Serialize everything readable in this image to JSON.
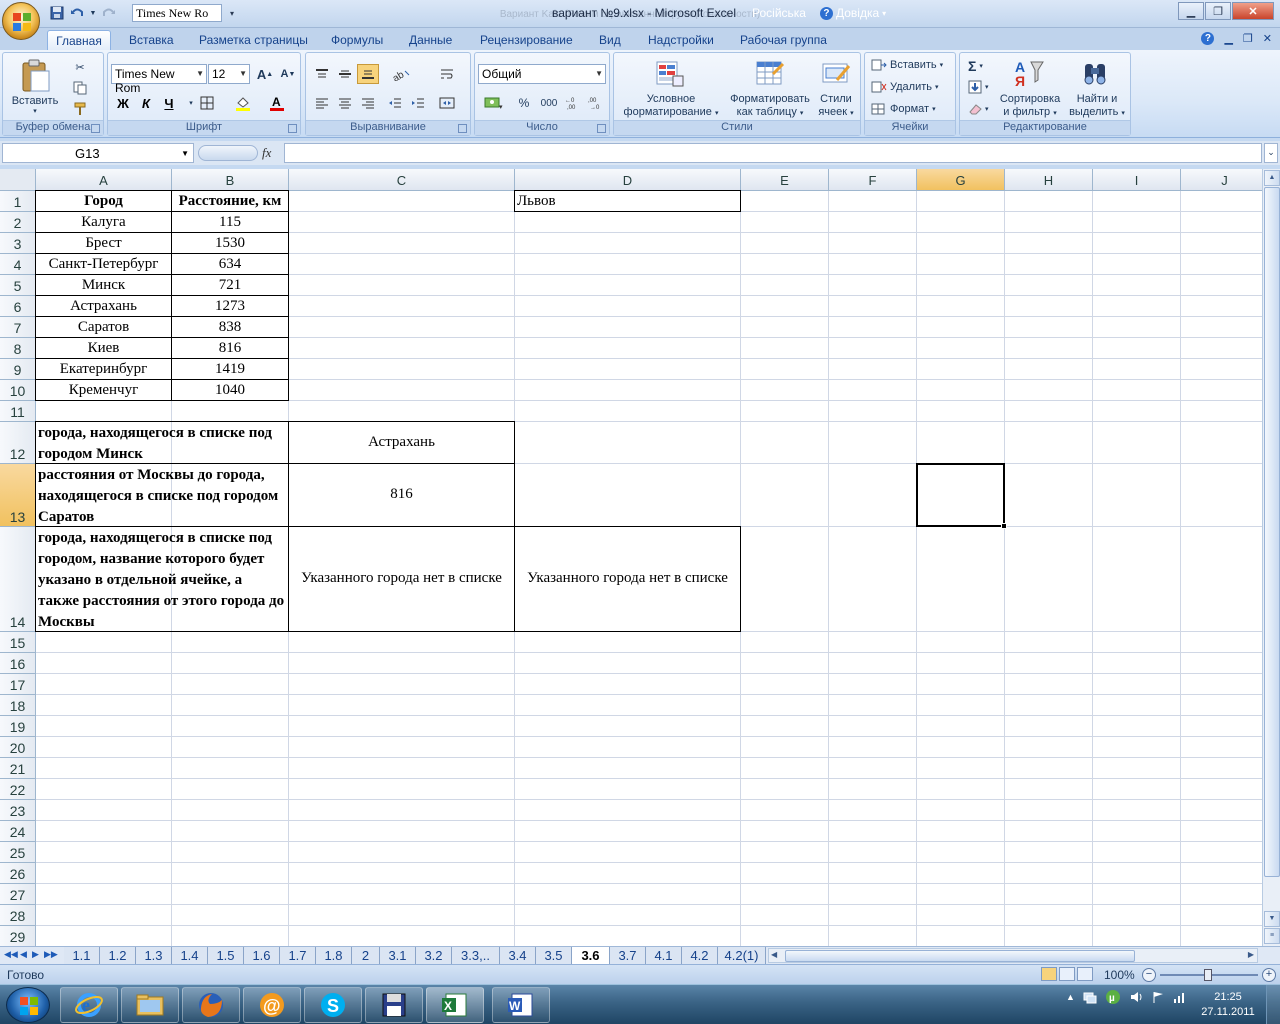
{
  "window": {
    "title": "вариант №9.xlsx - Microsoft Excel",
    "title_faded": "Вариант Kalo (Режим ограниченной функциональности)",
    "language": "Російська",
    "help_label": "Довідка",
    "qat_font": "Times New Ro"
  },
  "tabs": [
    "Главная",
    "Вставка",
    "Разметка страницы",
    "Формулы",
    "Данные",
    "Рецензирование",
    "Вид",
    "Надстройки",
    "Рабочая группа"
  ],
  "ribbon": {
    "clipboard": {
      "paste": "Вставить",
      "label": "Буфер обмена"
    },
    "font": {
      "name": "Times New Rom",
      "size": "12",
      "bold": "Ж",
      "italic": "К",
      "underline": "Ч",
      "label": "Шрифт"
    },
    "alignment": {
      "label": "Выравнивание"
    },
    "number": {
      "format": "Общий",
      "percent": "%",
      "thousands": "000",
      "label": "Число"
    },
    "styles": {
      "conditional": "Условное\nформатирование",
      "conditional_l1": "Условное",
      "conditional_l2": "форматирование",
      "table_l1": "Форматировать",
      "table_l2": "как таблицу",
      "cell_l1": "Стили",
      "cell_l2": "ячеек",
      "label": "Стили"
    },
    "cells": {
      "insert": "Вставить",
      "delete": "Удалить",
      "format": "Формат",
      "label": "Ячейки"
    },
    "editing": {
      "sigma": "Σ",
      "sort_l1": "Сортировка",
      "sort_l2": "и фильтр",
      "find_l1": "Найти и",
      "find_l2": "выделить",
      "label": "Редактирование"
    }
  },
  "formula_bar": {
    "name_box": "G13",
    "fx": "fx",
    "formula": ""
  },
  "columns": [
    "A",
    "B",
    "C",
    "D",
    "E",
    "F",
    "G",
    "H",
    "I",
    "J"
  ],
  "selected_column": "G",
  "selected_row": "13",
  "rows": [
    "1",
    "2",
    "3",
    "4",
    "5",
    "6",
    "7",
    "8",
    "9",
    "10",
    "11",
    "12",
    "13",
    "14",
    "15",
    "16",
    "17",
    "18",
    "19",
    "20",
    "21",
    "22",
    "23",
    "24",
    "25",
    "26",
    "27",
    "28",
    "29"
  ],
  "cells": {
    "A1": "Город",
    "B1": "Расстояние, км",
    "D1": "Львов",
    "A2": "Калуга",
    "B2": "115",
    "A3": "Брест",
    "B3": "1530",
    "A4": "Санкт-Петербург",
    "B4": "634",
    "A5": "Минск",
    "B5": "721",
    "A6": "Астрахань",
    "B6": "1273",
    "A7": "Саратов",
    "B7": "838",
    "A8": "Киев",
    "B8": "816",
    "A9": "Екатеринбург",
    "B9": "1419",
    "A10": "Кременчуг",
    "B10": "1040",
    "A12": "города, находящегося в списке под городом Минск",
    "C12": "Астрахань",
    "A13": "расстояния от Москвы до города, находящегося в списке под городом Саратов",
    "C13": "816",
    "A14": "города, находящегося в списке под городом, название которого будет указано в отдельной ячейке, а также расстояния от этого города до Москвы",
    "C14": "Указанного города нет в списке",
    "D14": "Указанного города нет в списке"
  },
  "sheet_tabs": [
    "1.1",
    "1.2",
    "1.3",
    "1.4",
    "1.5",
    "1.6",
    "1.7",
    "1.8",
    "2",
    "3.1",
    "3.2",
    "3.3,..",
    "3.4",
    "3.5",
    "3.6",
    "3.7",
    "4.1",
    "4.2",
    "4.2(1)"
  ],
  "active_sheet": "3.6",
  "status": {
    "text": "Готово",
    "zoom": "100%"
  },
  "taskbar": {
    "time": "21:25",
    "date": "27.11.2011"
  }
}
